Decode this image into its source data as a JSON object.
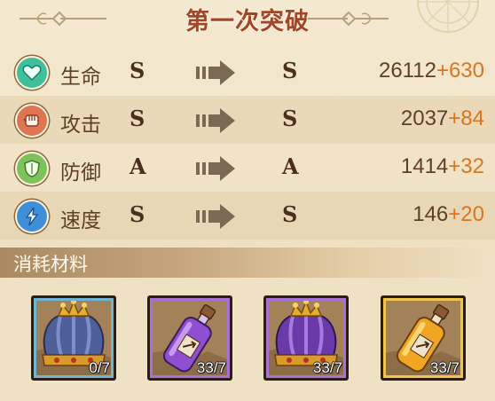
{
  "title": "第一次突破",
  "stats": [
    {
      "name": "生命",
      "icon": "heart-icon",
      "color": "#3fbf9a",
      "from": "S",
      "to": "S",
      "base": "26112",
      "bonus": "+630"
    },
    {
      "name": "攻击",
      "icon": "fist-icon",
      "color": "#e07552",
      "from": "S",
      "to": "S",
      "base": "2037",
      "bonus": "+84"
    },
    {
      "name": "防御",
      "icon": "shield-icon",
      "color": "#7cc15a",
      "from": "A",
      "to": "A",
      "base": "1414",
      "bonus": "+32"
    },
    {
      "name": "速度",
      "icon": "lightning-icon",
      "color": "#3f8fd8",
      "from": "S",
      "to": "S",
      "base": "146",
      "bonus": "+20"
    }
  ],
  "materials_header": "消耗材料",
  "materials": [
    {
      "item": "blue-crown",
      "count": "0/7",
      "frame": "#6fb6d6"
    },
    {
      "item": "purple-potion",
      "count": "33/7",
      "frame": "#a672d6"
    },
    {
      "item": "purple-crown",
      "count": "33/7",
      "frame": "#a672d6"
    },
    {
      "item": "gold-potion",
      "count": "33/7",
      "frame": "#efc44f"
    }
  ]
}
